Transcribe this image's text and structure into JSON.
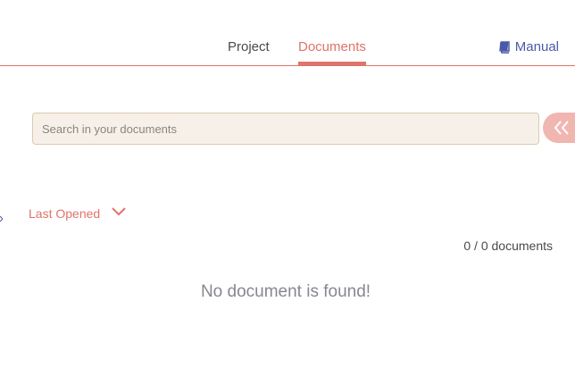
{
  "nav": {
    "tabs": [
      {
        "label": "Project",
        "active": false
      },
      {
        "label": "Documents",
        "active": true
      }
    ],
    "manual_label": "Manual"
  },
  "search": {
    "placeholder": "Search in your documents",
    "value": ""
  },
  "sort": {
    "selected": "Last Opened"
  },
  "documents": {
    "count_text": "0 / 0 documents",
    "empty_message": "No document is found!"
  },
  "colors": {
    "accent": "#e0736b",
    "link": "#4a5aa8",
    "search_bg": "#f6f0e8",
    "collapse_bg": "#f1b6b0"
  },
  "icons": {
    "manual": "book-icon",
    "collapse": "double-chevron-left-icon",
    "sort": "chevron-down-icon"
  }
}
